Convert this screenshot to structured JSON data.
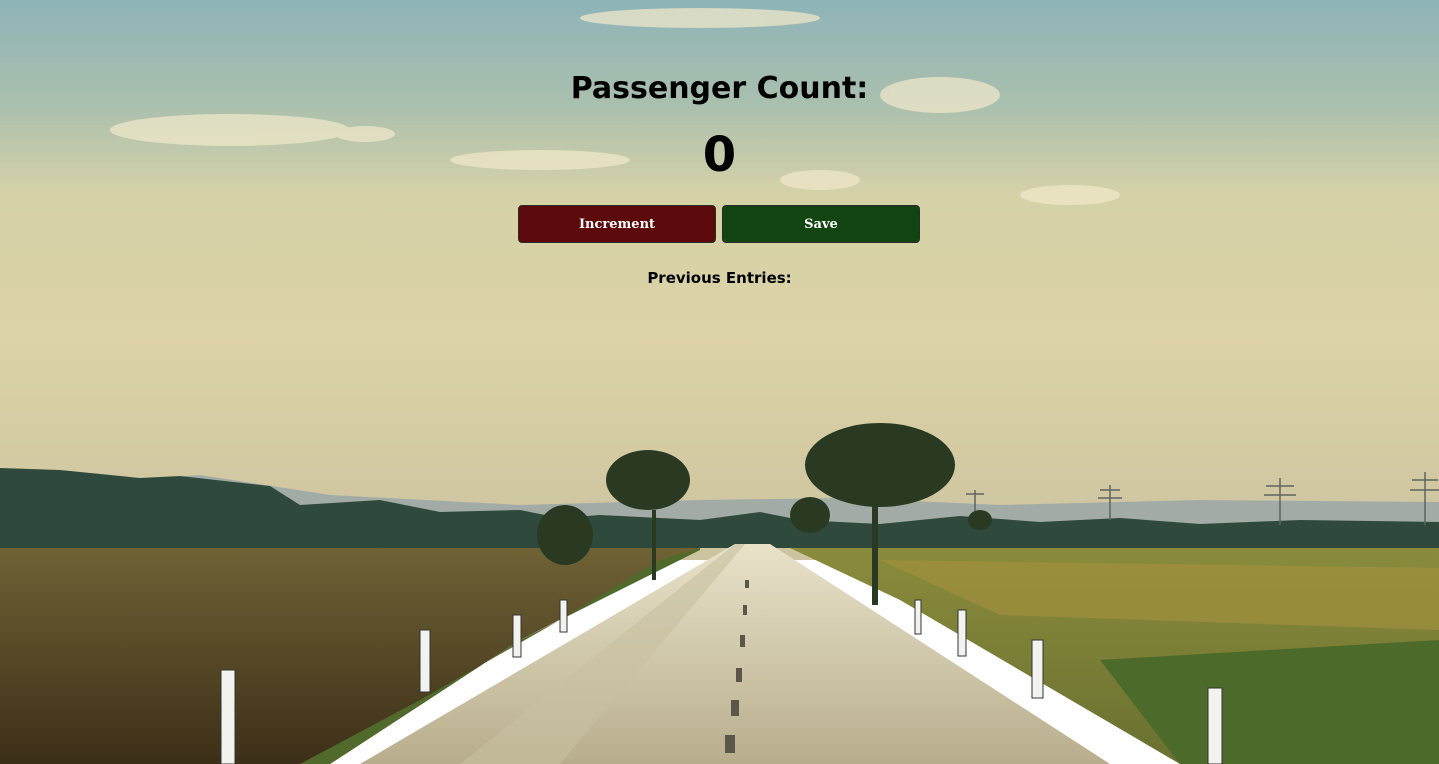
{
  "counter": {
    "title": "Passenger Count:",
    "value": "0"
  },
  "buttons": {
    "increment_label": "Increment",
    "save_label": "Save"
  },
  "entries": {
    "label": "Previous Entries:"
  },
  "colors": {
    "increment_button": "#5c0a0b",
    "save_button": "#124512"
  }
}
